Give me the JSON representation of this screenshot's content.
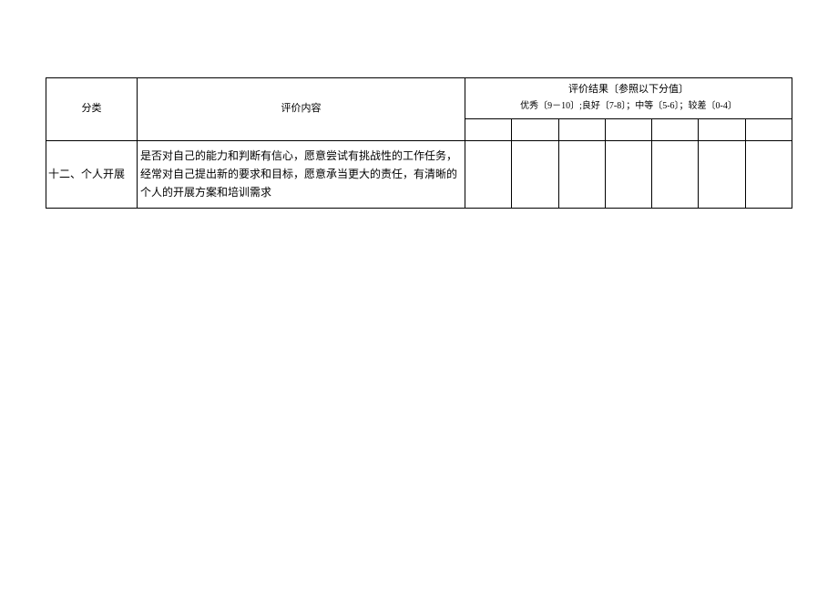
{
  "table": {
    "headers": {
      "category": "分类",
      "content": "评价内容",
      "result_title": "评价结果〔参照以下分值〕",
      "result_scale": "优秀〔9－10〕;良好〔7-8〕；中等〔5-6〕；较差〔0-4〕"
    },
    "rows": [
      {
        "category": "十二、个人开展",
        "content": "是否对自己的能力和判断有信心，愿意尝试有挑战性的工作任务，经常对自己提出新的要求和目标，愿意承当更大的责任，有清晰的个人的开展方案和培训需求"
      }
    ]
  }
}
